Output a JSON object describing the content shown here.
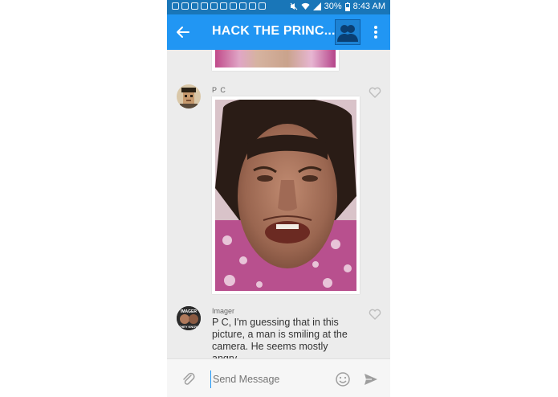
{
  "status_bar": {
    "battery": "30%",
    "time": "8:43 AM"
  },
  "app_bar": {
    "title": "HACK THE PRINC..."
  },
  "messages": [
    {
      "sender": "P C",
      "type": "image"
    },
    {
      "sender": "Imager",
      "text": "P C, I'm guessing that in this picture, a man is smiling at the camera. He seems mostly angry."
    }
  ],
  "imager_avatar_text": [
    "IMAGER",
    "THEY KNOW"
  ],
  "compose": {
    "placeholder": "Send Message"
  },
  "colors": {
    "app_bar": "#2196f3",
    "status_bar": "#1976b8",
    "background": "#ececec"
  }
}
